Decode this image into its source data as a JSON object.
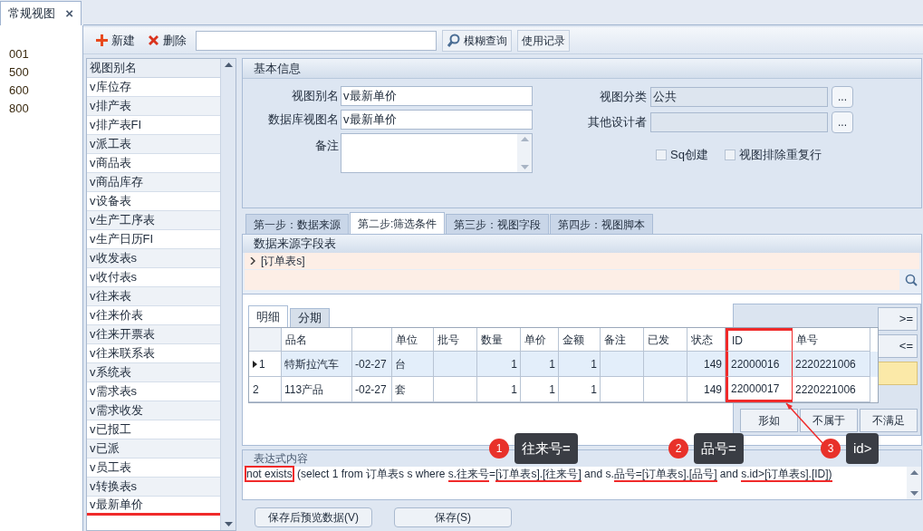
{
  "side_tab": {
    "label": "常规视图",
    "close": "×"
  },
  "side_list": [
    "001",
    "500",
    "600",
    "800"
  ],
  "toolbar": {
    "new": "新建",
    "delete": "删除",
    "fuzzy": "模糊查询",
    "history": "使用记录"
  },
  "view_list": {
    "header": "视图别名",
    "items": [
      {
        "label": "v库位存",
        "selected": false
      },
      {
        "label": "v排产表",
        "selected": false
      },
      {
        "label": "v排产表FI",
        "selected": false
      },
      {
        "label": "v派工表",
        "selected": false
      },
      {
        "label": "v商品表",
        "selected": false
      },
      {
        "label": "v商品库存",
        "selected": false
      },
      {
        "label": "v设备表",
        "selected": false
      },
      {
        "label": "v生产工序表",
        "selected": false
      },
      {
        "label": "v生产日历FI",
        "selected": false
      },
      {
        "label": "v收发表s",
        "selected": false
      },
      {
        "label": "v收付表s",
        "selected": false
      },
      {
        "label": "v往来表",
        "selected": false
      },
      {
        "label": "v往来价表",
        "selected": false
      },
      {
        "label": "v往来开票表",
        "selected": false
      },
      {
        "label": "v往来联系表",
        "selected": false
      },
      {
        "label": "v系统表",
        "selected": false
      },
      {
        "label": "v需求表s",
        "selected": false
      },
      {
        "label": "v需求收发",
        "selected": false
      },
      {
        "label": "v已报工",
        "selected": false
      },
      {
        "label": "v已派",
        "selected": false
      },
      {
        "label": "v员工表",
        "selected": false
      },
      {
        "label": "v转换表s",
        "selected": false
      },
      {
        "label": "v最新单价",
        "selected": true
      }
    ]
  },
  "basic_info": {
    "title": "基本信息",
    "alias_label": "视图别名",
    "alias": "v最新单价",
    "db_label": "数据库视图名",
    "db_name": "v最新单价",
    "note_label": "备注",
    "category_label": "视图分类",
    "category": "公共",
    "designer_label": "其他设计者",
    "more": "...",
    "checks": [
      {
        "label": "Sq创建",
        "checked": false
      },
      {
        "label": "视图排除重复行",
        "checked": false
      }
    ]
  },
  "steps": [
    {
      "label": "第一步：数据来源",
      "selected": false
    },
    {
      "label": "第二步:筛选条件",
      "selected": true
    },
    {
      "label": "第三步：视图字段",
      "selected": false
    },
    {
      "label": "第四步：视图脚本",
      "selected": false
    }
  ],
  "source": {
    "title": "数据来源字段表",
    "node": "[订单表s]"
  },
  "grid": {
    "tabs": [
      {
        "label": "明细",
        "selected": true
      },
      {
        "label": "分期",
        "selected": false
      }
    ],
    "columns": [
      {
        "label": "品名",
        "highlighted": false
      },
      {
        "highlighted": false
      },
      {
        "label": "单位",
        "highlighted": false
      },
      {
        "label": "批号",
        "highlighted": false
      },
      {
        "label": "数量",
        "highlighted": false
      },
      {
        "label": "单价",
        "highlighted": false
      },
      {
        "label": "金额",
        "highlighted": false
      },
      {
        "label": "备注",
        "highlighted": false
      },
      {
        "label": "已发",
        "highlighted": false
      },
      {
        "label": "状态",
        "highlighted": false
      },
      {
        "label": "ID",
        "highlighted": true
      },
      {
        "label": "单号",
        "highlighted": false
      }
    ],
    "rows": [
      {
        "num": "1",
        "current": true,
        "cells": [
          "特斯拉汽车",
          "-02-27",
          "台",
          "",
          "1",
          "1",
          "1",
          "",
          "",
          "149",
          "22000016",
          "2220221006"
        ]
      },
      {
        "num": "2",
        "current": false,
        "cells": [
          "113产品",
          "-02-27",
          "套",
          "",
          "1",
          "1",
          "1",
          "",
          "",
          "149",
          "22000017",
          "2220221006"
        ]
      }
    ]
  },
  "operators": [
    ">=",
    "<="
  ],
  "operator_row": [
    "形如",
    "不属于",
    "不满足"
  ],
  "expression": {
    "title": "表达式内容",
    "segments": [
      {
        "text": "not exists",
        "kind": "boxed"
      },
      {
        "text": " (select 1 from 订单表s s where ",
        "kind": "plain"
      },
      {
        "text": "s.往来号",
        "kind": "underlined"
      },
      {
        "text": "=",
        "kind": "plain"
      },
      {
        "text": "[订单表s].[往来号]",
        "kind": "underlined"
      },
      {
        "text": " and s.",
        "kind": "plain"
      },
      {
        "text": "品号=[订单表s].[品号]",
        "kind": "underlined"
      },
      {
        "text": " and ",
        "kind": "plain"
      },
      {
        "text": "s.id>",
        "kind": "underlined"
      },
      {
        "text": "[订单表s].[ID])",
        "kind": "underlined"
      }
    ]
  },
  "callouts": [
    {
      "number": "1",
      "text": "往来号="
    },
    {
      "number": "2",
      "text": "品号="
    },
    {
      "number": "3",
      "text": "id>"
    }
  ],
  "buttons": [
    "保存后预览数据(V)",
    "保存(S)"
  ]
}
